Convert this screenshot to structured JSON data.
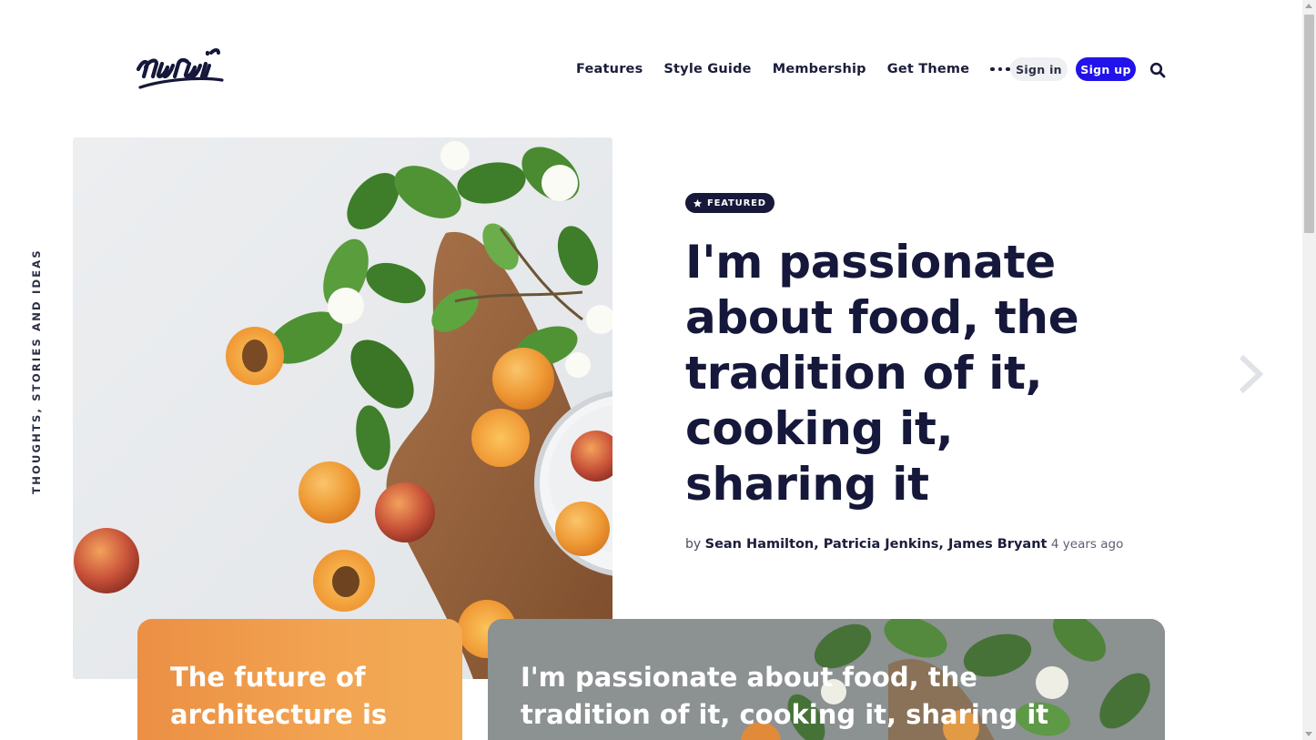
{
  "brand": {
    "logo_text": "nurui"
  },
  "nav": {
    "items": [
      "Features",
      "Style Guide",
      "Membership",
      "Get Theme"
    ],
    "more_icon": "more-horizontal-icon",
    "signin_label": "Sign in",
    "signup_label": "Sign up",
    "search_icon": "search-icon"
  },
  "colors": {
    "text_dark": "#15183a",
    "primary": "#2113ea",
    "featured_badge": "#17193a",
    "card_orange": "#f2a451",
    "card_grey": "#8c9192"
  },
  "tagline": "THOUGHTS, STORIES AND IDEAS",
  "featured": {
    "badge_icon": "star-icon",
    "badge_label": "FEATURED",
    "title": "I'm passionate about food, the tradition of it, cooking it, sharing it",
    "byline_prefix": "by",
    "authors": "Sean Hamilton, Patricia Jenkins, James Bryant",
    "time_ago": "4 years ago"
  },
  "carousel": {
    "next_icon": "chevron-right-icon"
  },
  "cards": [
    {
      "title": "The future of architecture is"
    },
    {
      "title": "I'm passionate about food, the tradition of it, cooking it, sharing it"
    }
  ]
}
